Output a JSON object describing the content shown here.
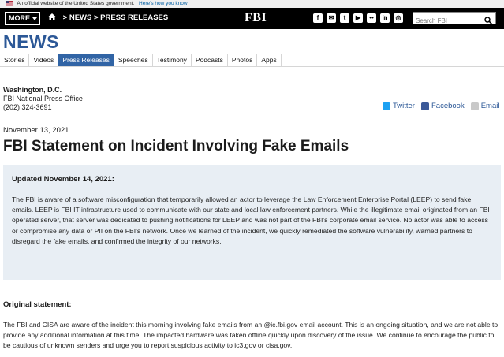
{
  "gov_banner": {
    "text": "An official website of the United States government.",
    "link": "Here's how you know"
  },
  "topbar": {
    "more_label": "MORE",
    "breadcrumb_news": "> NEWS",
    "breadcrumb_press": "> PRESS RELEASES",
    "logo": "FBI",
    "search_placeholder": "Search FBI",
    "social_icons": [
      "facebook-icon",
      "email-icon",
      "twitter-icon",
      "youtube-icon",
      "flickr-icon",
      "linkedin-icon",
      "instagram-icon"
    ]
  },
  "section_title": "NEWS",
  "tabs": [
    {
      "label": "Stories"
    },
    {
      "label": "Videos"
    },
    {
      "label": "Press Releases",
      "active": true
    },
    {
      "label": "Speeches"
    },
    {
      "label": "Testimony"
    },
    {
      "label": "Podcasts"
    },
    {
      "label": "Photos"
    },
    {
      "label": "Apps"
    }
  ],
  "contact": {
    "city": "Washington, D.C.",
    "office": "FBI National Press Office",
    "phone": "(202) 324-3691"
  },
  "share": {
    "twitter": "Twitter",
    "facebook": "Facebook",
    "email": "Email"
  },
  "article": {
    "date": "November 13, 2021",
    "title": "FBI Statement on Incident Involving Fake Emails",
    "update_heading": "Updated November 14, 2021:",
    "update_text": "The FBI is aware of a software misconfiguration that temporarily allowed an actor to leverage the Law Enforcement Enterprise Portal (LEEP) to send fake emails. LEEP is FBI IT infrastructure used to communicate with our state and local law enforcement partners. While the illegitimate email originated from an FBI operated server, that server was dedicated to pushing notifications for LEEP and was not part of the FBI’s corporate email service. No actor was able to access or compromise any data or PII on the FBI’s network. Once we learned of the incident, we quickly remediated the software vulnerability, warned partners to disregard the fake emails, and confirmed the integrity of our networks.",
    "original_heading": "Original statement:",
    "original_text": "The FBI and CISA are aware of the incident this morning involving fake emails from an @ic.fbi.gov email account. This is an ongoing situation, and we are not able to provide any additional information at this time. The impacted hardware was taken offline quickly upon discovery of the issue. We continue to encourage the public to be cautious of unknown senders and urge you to report suspicious activity to ic3.gov or cisa.gov."
  }
}
